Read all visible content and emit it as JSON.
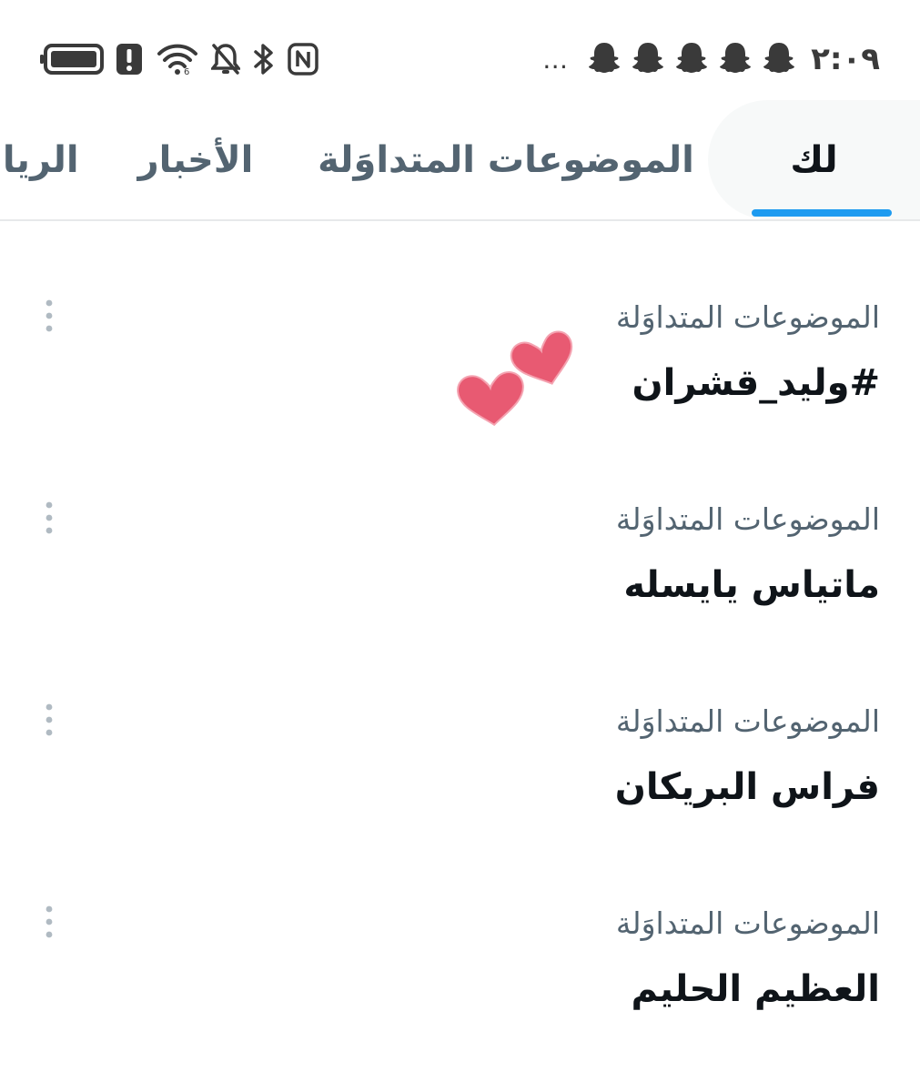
{
  "status_bar": {
    "time": "٢:٠٩",
    "more": "…",
    "notification_icons": [
      "snapchat-icon",
      "snapchat-icon",
      "snapchat-icon",
      "snapchat-icon",
      "snapchat-icon"
    ],
    "system_icons": [
      "battery-icon",
      "alert-icon",
      "wifi-icon",
      "bell-off-icon",
      "bluetooth-icon",
      "nfc-icon"
    ]
  },
  "tabs": {
    "for_you": "لك",
    "trending": "الموضوعات المتداوَلة",
    "news": "الأخبار",
    "sports": "الرياضة",
    "active": "for_you"
  },
  "trends": [
    {
      "category": "الموضوعات المتداوَلة",
      "name": "#وليد_قشران"
    },
    {
      "category": "الموضوعات المتداوَلة",
      "name": "ماتياس يايسله"
    },
    {
      "category": "الموضوعات المتداوَلة",
      "name": "فراس البريكان"
    },
    {
      "category": "الموضوعات المتداوَلة",
      "name": "العظيم الحليم"
    }
  ],
  "colors": {
    "accent": "#1d9bf0",
    "text_primary": "#0f1419",
    "text_secondary": "#536471",
    "heart": "#e85a72"
  }
}
